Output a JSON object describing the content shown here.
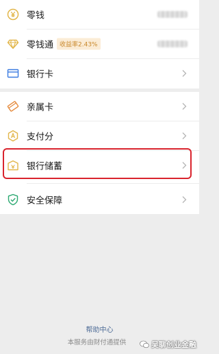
{
  "menu": {
    "items": [
      {
        "label": "零钱",
        "icon": "coin-yuan-icon"
      },
      {
        "label": "零钱通",
        "icon": "diamond-icon",
        "badge": "收益率2.43%"
      },
      {
        "label": "银行卡",
        "icon": "bank-card-icon"
      },
      {
        "label": "亲属卡",
        "icon": "family-card-icon"
      },
      {
        "label": "支付分",
        "icon": "pay-score-icon"
      },
      {
        "label": "银行储蓄",
        "icon": "bank-savings-icon"
      },
      {
        "label": "安全保障",
        "icon": "shield-check-icon"
      }
    ]
  },
  "footer": {
    "help_link": "帮助中心",
    "service_text": "本服务由财付通提供"
  },
  "watermark": {
    "text": "吴聊创业金融"
  },
  "colors": {
    "accent_gold": "#e2b64a",
    "accent_blue": "#3b7be0",
    "accent_green": "#2aa870",
    "highlight_red": "#d9232d",
    "badge_text": "#c9892d"
  }
}
